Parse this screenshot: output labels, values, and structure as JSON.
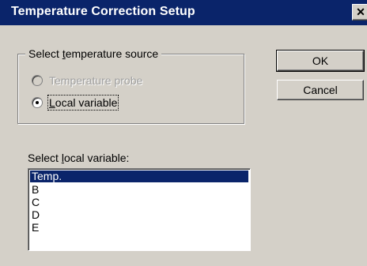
{
  "window": {
    "title": "Temperature Correction Setup",
    "close_label": "✕"
  },
  "source_group": {
    "legend_pre": "Select ",
    "legend_key": "t",
    "legend_post": "emperature source",
    "options": [
      {
        "label": "Temperature probe",
        "selected": false,
        "enabled": false
      },
      {
        "label_key": "L",
        "label_rest": "ocal variable",
        "selected": true,
        "enabled": true
      }
    ]
  },
  "buttons": {
    "ok_label": "OK",
    "cancel_label": "Cancel"
  },
  "variable_list": {
    "label_pre": "Select ",
    "label_key": "l",
    "label_post": "ocal variable:",
    "items": [
      "Temp.",
      "B",
      "C",
      "D",
      "E"
    ],
    "selected_index": 0
  }
}
